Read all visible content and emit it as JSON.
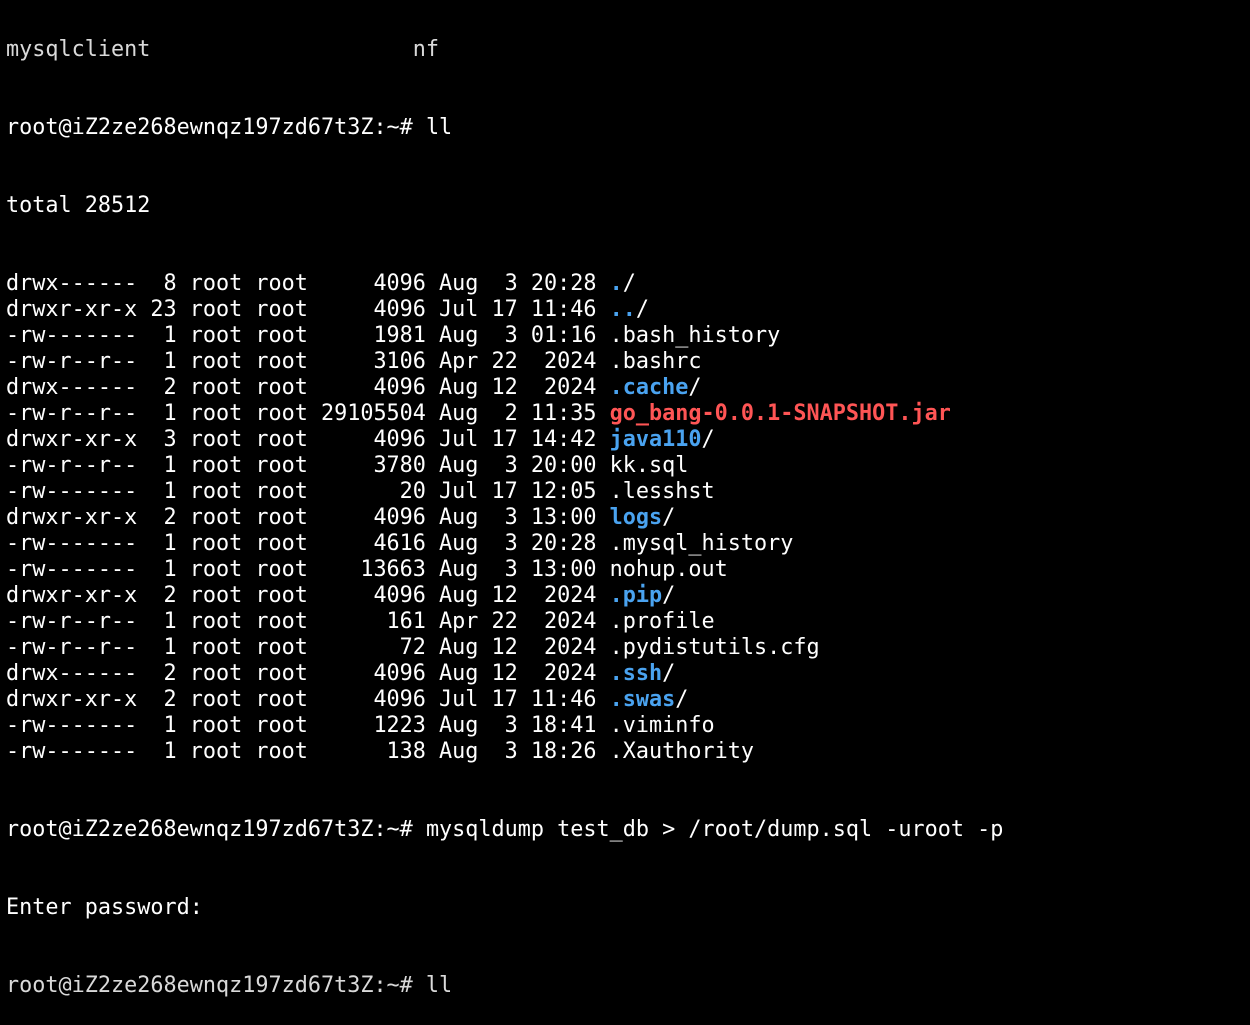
{
  "terminal": {
    "top_cut_line": "mysqlclient                    nf",
    "prompt": "root@iZ2ze268ewnqz197zd67t3Z:~#",
    "command1": "ll",
    "total": "total 28512",
    "entries": [
      {
        "perm": "drwx------",
        "links": "8",
        "owner": "root",
        "group": "root",
        "size": "4096",
        "month": "Aug",
        "day": "3",
        "time": "20:28",
        "name": ".",
        "type": "dir"
      },
      {
        "perm": "drwxr-xr-x",
        "links": "23",
        "owner": "root",
        "group": "root",
        "size": "4096",
        "month": "Jul",
        "day": "17",
        "time": "11:46",
        "name": "..",
        "type": "dir"
      },
      {
        "perm": "-rw-------",
        "links": "1",
        "owner": "root",
        "group": "root",
        "size": "1981",
        "month": "Aug",
        "day": "3",
        "time": "01:16",
        "name": ".bash_history",
        "type": "file"
      },
      {
        "perm": "-rw-r--r--",
        "links": "1",
        "owner": "root",
        "group": "root",
        "size": "3106",
        "month": "Apr",
        "day": "22",
        "time": "2024",
        "name": ".bashrc",
        "type": "file"
      },
      {
        "perm": "drwx------",
        "links": "2",
        "owner": "root",
        "group": "root",
        "size": "4096",
        "month": "Aug",
        "day": "12",
        "time": "2024",
        "name": ".cache",
        "type": "dir"
      },
      {
        "perm": "-rw-r--r--",
        "links": "1",
        "owner": "root",
        "group": "root",
        "size": "29105504",
        "month": "Aug",
        "day": "2",
        "time": "11:35",
        "name": "go_bang-0.0.1-SNAPSHOT.jar",
        "type": "archive"
      },
      {
        "perm": "drwxr-xr-x",
        "links": "3",
        "owner": "root",
        "group": "root",
        "size": "4096",
        "month": "Jul",
        "day": "17",
        "time": "14:42",
        "name": "java110",
        "type": "dir"
      },
      {
        "perm": "-rw-r--r--",
        "links": "1",
        "owner": "root",
        "group": "root",
        "size": "3780",
        "month": "Aug",
        "day": "3",
        "time": "20:00",
        "name": "kk.sql",
        "type": "file"
      },
      {
        "perm": "-rw-------",
        "links": "1",
        "owner": "root",
        "group": "root",
        "size": "20",
        "month": "Jul",
        "day": "17",
        "time": "12:05",
        "name": ".lesshst",
        "type": "file"
      },
      {
        "perm": "drwxr-xr-x",
        "links": "2",
        "owner": "root",
        "group": "root",
        "size": "4096",
        "month": "Aug",
        "day": "3",
        "time": "13:00",
        "name": "logs",
        "type": "dir"
      },
      {
        "perm": "-rw-------",
        "links": "1",
        "owner": "root",
        "group": "root",
        "size": "4616",
        "month": "Aug",
        "day": "3",
        "time": "20:28",
        "name": ".mysql_history",
        "type": "file"
      },
      {
        "perm": "-rw-------",
        "links": "1",
        "owner": "root",
        "group": "root",
        "size": "13663",
        "month": "Aug",
        "day": "3",
        "time": "13:00",
        "name": "nohup.out",
        "type": "file"
      },
      {
        "perm": "drwxr-xr-x",
        "links": "2",
        "owner": "root",
        "group": "root",
        "size": "4096",
        "month": "Aug",
        "day": "12",
        "time": "2024",
        "name": ".pip",
        "type": "dir"
      },
      {
        "perm": "-rw-r--r--",
        "links": "1",
        "owner": "root",
        "group": "root",
        "size": "161",
        "month": "Apr",
        "day": "22",
        "time": "2024",
        "name": ".profile",
        "type": "file"
      },
      {
        "perm": "-rw-r--r--",
        "links": "1",
        "owner": "root",
        "group": "root",
        "size": "72",
        "month": "Aug",
        "day": "12",
        "time": "2024",
        "name": ".pydistutils.cfg",
        "type": "file"
      },
      {
        "perm": "drwx------",
        "links": "2",
        "owner": "root",
        "group": "root",
        "size": "4096",
        "month": "Aug",
        "day": "12",
        "time": "2024",
        "name": ".ssh",
        "type": "dir"
      },
      {
        "perm": "drwxr-xr-x",
        "links": "2",
        "owner": "root",
        "group": "root",
        "size": "4096",
        "month": "Jul",
        "day": "17",
        "time": "11:46",
        "name": ".swas",
        "type": "dir"
      },
      {
        "perm": "-rw-------",
        "links": "1",
        "owner": "root",
        "group": "root",
        "size": "1223",
        "month": "Aug",
        "day": "3",
        "time": "18:41",
        "name": ".viminfo",
        "type": "file"
      },
      {
        "perm": "-rw-------",
        "links": "1",
        "owner": "root",
        "group": "root",
        "size": "138",
        "month": "Aug",
        "day": "3",
        "time": "18:26",
        "name": ".Xauthority",
        "type": "file"
      }
    ],
    "command2": "mysqldump test_db > /root/dump.sql -uroot -p",
    "password_prompt": "Enter password:",
    "bottom_cut_line": "root@iZ2ze268ewnqz197zd67t3Z:~# ll",
    "colors": {
      "background": "#000000",
      "text": "#ffffff",
      "directory": "#4aa3f0",
      "archive": "#ff5555"
    }
  }
}
